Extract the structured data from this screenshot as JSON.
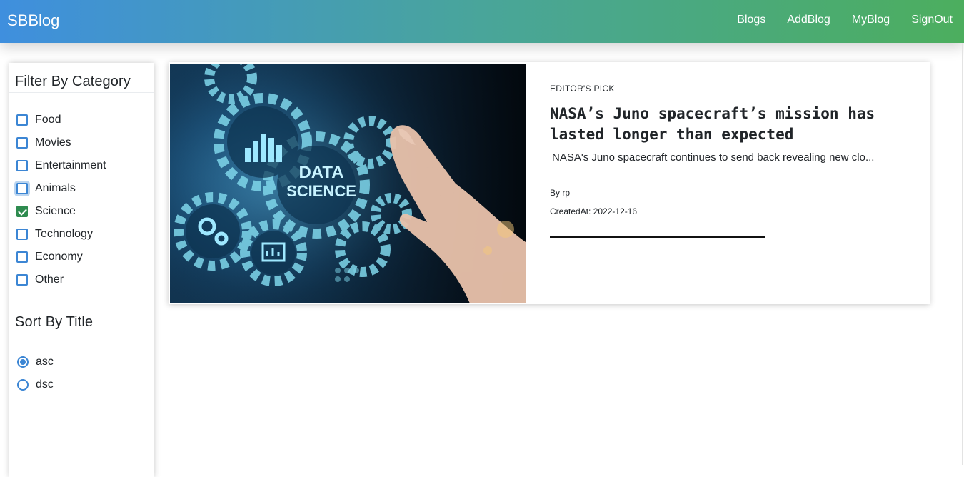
{
  "navbar": {
    "brand": "SBBlog",
    "links": [
      "Blogs",
      "AddBlog",
      "MyBlog",
      "SignOut"
    ]
  },
  "sidebar": {
    "filter_heading": "Filter By Category",
    "categories": [
      {
        "label": "Food",
        "checked": false
      },
      {
        "label": "Movies",
        "checked": false
      },
      {
        "label": "Entertainment",
        "checked": false
      },
      {
        "label": "Animals",
        "checked": false,
        "focused": true
      },
      {
        "label": "Science",
        "checked": true
      },
      {
        "label": "Technology",
        "checked": false
      },
      {
        "label": "Economy",
        "checked": false
      },
      {
        "label": "Other",
        "checked": false
      }
    ],
    "sort_heading": "Sort By Title",
    "sort_options": [
      {
        "label": "asc",
        "selected": true
      },
      {
        "label": "dsc",
        "selected": false
      }
    ]
  },
  "card": {
    "image_text": {
      "line1": "DATA",
      "line2": "SCIENCE"
    },
    "eyebrow": "EDITOR'S PICK",
    "title": "NASA’s Juno spacecraft’s mission has lasted longer than expected",
    "excerpt": "NASA's Juno spacecraft continues to send back revealing new clo...",
    "author": "By rp",
    "created": "CreatedAt: 2022-12-16"
  },
  "colors": {
    "nav_gradient_start": "#3f8fde",
    "nav_gradient_end": "#4cae5e",
    "checkbox_border": "#3c86d4",
    "checkbox_checked": "#2e8b4f"
  }
}
